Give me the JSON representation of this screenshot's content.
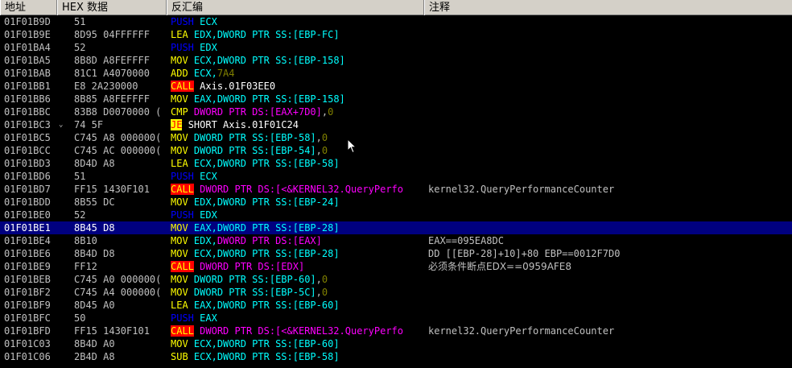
{
  "header": {
    "address": "地址",
    "hex": "HEX 数据",
    "disasm": "反汇编",
    "comment": "注释"
  },
  "rows": [
    {
      "addr": "01F01B9D",
      "mark": "",
      "hex": "51",
      "mn": "PUSH",
      "mnType": "push",
      "ops": [
        {
          "t": "ECX",
          "c": "#00ffff"
        }
      ],
      "cmt": ""
    },
    {
      "addr": "01F01B9E",
      "mark": "",
      "hex": "8D95 04FFFFFF",
      "mn": "LEA",
      "mnType": "norm",
      "ops": [
        {
          "t": "EDX,",
          "c": "#00ffff"
        },
        {
          "t": "DWORD PTR SS:[EBP-FC]",
          "c": "#00ffff"
        }
      ],
      "cmt": ""
    },
    {
      "addr": "01F01BA4",
      "mark": "",
      "hex": "52",
      "mn": "PUSH",
      "mnType": "push",
      "ops": [
        {
          "t": "EDX",
          "c": "#00ffff"
        }
      ],
      "cmt": ""
    },
    {
      "addr": "01F01BA5",
      "mark": "",
      "hex": "8B8D A8FEFFFF",
      "mn": "MOV",
      "mnType": "norm",
      "ops": [
        {
          "t": "ECX,",
          "c": "#00ffff"
        },
        {
          "t": "DWORD PTR SS:[EBP-158]",
          "c": "#00ffff"
        }
      ],
      "cmt": ""
    },
    {
      "addr": "01F01BAB",
      "mark": "",
      "hex": "81C1 A4070000",
      "mn": "ADD",
      "mnType": "norm",
      "ops": [
        {
          "t": "ECX,",
          "c": "#00ffff"
        },
        {
          "t": "7A4",
          "c": "#808000"
        }
      ],
      "cmt": ""
    },
    {
      "addr": "01F01BB1",
      "mark": "",
      "hex": "E8 2A230000",
      "mn": "CALL",
      "mnType": "call",
      "ops": [
        {
          "t": "Axis.01F03EE0",
          "c": "#ffffff"
        }
      ],
      "cmt": ""
    },
    {
      "addr": "01F01BB6",
      "mark": "",
      "hex": "8B85 A8FEFFFF",
      "mn": "MOV",
      "mnType": "norm",
      "ops": [
        {
          "t": "EAX,",
          "c": "#00ffff"
        },
        {
          "t": "DWORD PTR SS:[EBP-158]",
          "c": "#00ffff"
        }
      ],
      "cmt": ""
    },
    {
      "addr": "01F01BBC",
      "mark": "",
      "hex": "83B8 D0070000 (",
      "mn": "CMP",
      "mnType": "norm",
      "ops": [
        {
          "t": "DWORD PTR DS:[EAX+7D0]",
          "c": "#ff00ff"
        },
        {
          "t": ",",
          "c": "#c0c0c0"
        },
        {
          "t": "0",
          "c": "#808000"
        }
      ],
      "cmt": ""
    },
    {
      "addr": "01F01BC3",
      "mark": "⌄",
      "hex": "74 5F",
      "mn": "JE",
      "mnType": "je",
      "ops": [
        {
          "t": "SHORT Axis.01F01C24",
          "c": "#ffffff"
        }
      ],
      "cmt": ""
    },
    {
      "addr": "01F01BC5",
      "mark": "",
      "hex": "C745 A8 000000(",
      "mn": "MOV",
      "mnType": "norm",
      "ops": [
        {
          "t": "DWORD PTR SS:[EBP-58]",
          "c": "#00ffff"
        },
        {
          "t": ",",
          "c": "#c0c0c0"
        },
        {
          "t": "0",
          "c": "#808000"
        }
      ],
      "cmt": ""
    },
    {
      "addr": "01F01BCC",
      "mark": "",
      "hex": "C745 AC 000000(",
      "mn": "MOV",
      "mnType": "norm",
      "ops": [
        {
          "t": "DWORD PTR SS:[EBP-54]",
          "c": "#00ffff"
        },
        {
          "t": ",",
          "c": "#c0c0c0"
        },
        {
          "t": "0",
          "c": "#808000"
        }
      ],
      "cmt": ""
    },
    {
      "addr": "01F01BD3",
      "mark": "",
      "hex": "8D4D A8",
      "mn": "LEA",
      "mnType": "norm",
      "ops": [
        {
          "t": "ECX,",
          "c": "#00ffff"
        },
        {
          "t": "DWORD PTR SS:[EBP-58]",
          "c": "#00ffff"
        }
      ],
      "cmt": ""
    },
    {
      "addr": "01F01BD6",
      "mark": "",
      "hex": "51",
      "mn": "PUSH",
      "mnType": "push",
      "ops": [
        {
          "t": "ECX",
          "c": "#00ffff"
        }
      ],
      "cmt": ""
    },
    {
      "addr": "01F01BD7",
      "mark": "",
      "hex": "FF15 1430F101",
      "mn": "CALL",
      "mnType": "call",
      "ops": [
        {
          "t": "DWORD PTR DS:[<&KERNEL32.QueryPerfo",
          "c": "#ff00ff"
        }
      ],
      "cmt": "kernel32.QueryPerformanceCounter"
    },
    {
      "addr": "01F01BDD",
      "mark": "",
      "hex": "8B55 DC",
      "mn": "MOV",
      "mnType": "norm",
      "ops": [
        {
          "t": "EDX,",
          "c": "#00ffff"
        },
        {
          "t": "DWORD PTR SS:[EBP-24]",
          "c": "#00ffff"
        }
      ],
      "cmt": ""
    },
    {
      "addr": "01F01BE0",
      "mark": "",
      "hex": "52",
      "mn": "PUSH",
      "mnType": "push",
      "ops": [
        {
          "t": "EDX",
          "c": "#00ffff"
        }
      ],
      "cmt": ""
    },
    {
      "addr": "01F01BE1",
      "mark": "",
      "hex": "8B45 D8",
      "mn": "MOV",
      "mnType": "norm",
      "ops": [
        {
          "t": "EAX,",
          "c": "#00ffff"
        },
        {
          "t": "DWORD PTR SS:[EBP-28]",
          "c": "#00ffff"
        }
      ],
      "cmt": "",
      "selected": true
    },
    {
      "addr": "01F01BE4",
      "mark": "",
      "hex": "8B10",
      "mn": "MOV",
      "mnType": "norm",
      "ops": [
        {
          "t": "EDX,",
          "c": "#00ffff"
        },
        {
          "t": "DWORD PTR DS:[EAX]",
          "c": "#ff00ff"
        }
      ],
      "cmt": "EAX==095EA8DC"
    },
    {
      "addr": "01F01BE6",
      "mark": "",
      "hex": "8B4D D8",
      "mn": "MOV",
      "mnType": "norm",
      "ops": [
        {
          "t": "ECX,",
          "c": "#00ffff"
        },
        {
          "t": "DWORD PTR SS:[EBP-28]",
          "c": "#00ffff"
        }
      ],
      "cmt": "DD [[EBP-28]+10]+80 EBP==0012F7D0"
    },
    {
      "addr": "01F01BE9",
      "mark": "",
      "hex": "FF12",
      "mn": "CALL",
      "mnType": "call",
      "ops": [
        {
          "t": "DWORD PTR DS:[EDX]",
          "c": "#ff00ff"
        }
      ],
      "cmt": "必须条件断点EDX==0959AFE8"
    },
    {
      "addr": "01F01BEB",
      "mark": "",
      "hex": "C745 A0 000000(",
      "mn": "MOV",
      "mnType": "norm",
      "ops": [
        {
          "t": "DWORD PTR SS:[EBP-60]",
          "c": "#00ffff"
        },
        {
          "t": ",",
          "c": "#c0c0c0"
        },
        {
          "t": "0",
          "c": "#808000"
        }
      ],
      "cmt": ""
    },
    {
      "addr": "01F01BF2",
      "mark": "",
      "hex": "C745 A4 000000(",
      "mn": "MOV",
      "mnType": "norm",
      "ops": [
        {
          "t": "DWORD PTR SS:[EBP-5C]",
          "c": "#00ffff"
        },
        {
          "t": ",",
          "c": "#c0c0c0"
        },
        {
          "t": "0",
          "c": "#808000"
        }
      ],
      "cmt": ""
    },
    {
      "addr": "01F01BF9",
      "mark": "",
      "hex": "8D45 A0",
      "mn": "LEA",
      "mnType": "norm",
      "ops": [
        {
          "t": "EAX,",
          "c": "#00ffff"
        },
        {
          "t": "DWORD PTR SS:[EBP-60]",
          "c": "#00ffff"
        }
      ],
      "cmt": ""
    },
    {
      "addr": "01F01BFC",
      "mark": "",
      "hex": "50",
      "mn": "PUSH",
      "mnType": "push",
      "ops": [
        {
          "t": "EAX",
          "c": "#00ffff"
        }
      ],
      "cmt": ""
    },
    {
      "addr": "01F01BFD",
      "mark": "",
      "hex": "FF15 1430F101",
      "mn": "CALL",
      "mnType": "call",
      "ops": [
        {
          "t": "DWORD PTR DS:[<&KERNEL32.QueryPerfo",
          "c": "#ff00ff"
        }
      ],
      "cmt": "kernel32.QueryPerformanceCounter"
    },
    {
      "addr": "01F01C03",
      "mark": "",
      "hex": "8B4D A0",
      "mn": "MOV",
      "mnType": "norm",
      "ops": [
        {
          "t": "ECX,",
          "c": "#00ffff"
        },
        {
          "t": "DWORD PTR SS:[EBP-60]",
          "c": "#00ffff"
        }
      ],
      "cmt": ""
    },
    {
      "addr": "01F01C06",
      "mark": "",
      "hex": "2B4D A8",
      "mn": "SUB",
      "mnType": "norm",
      "ops": [
        {
          "t": "ECX,",
          "c": "#00ffff"
        },
        {
          "t": "DWORD PTR SS:[EBP-58]",
          "c": "#00ffff"
        }
      ],
      "cmt": ""
    }
  ]
}
